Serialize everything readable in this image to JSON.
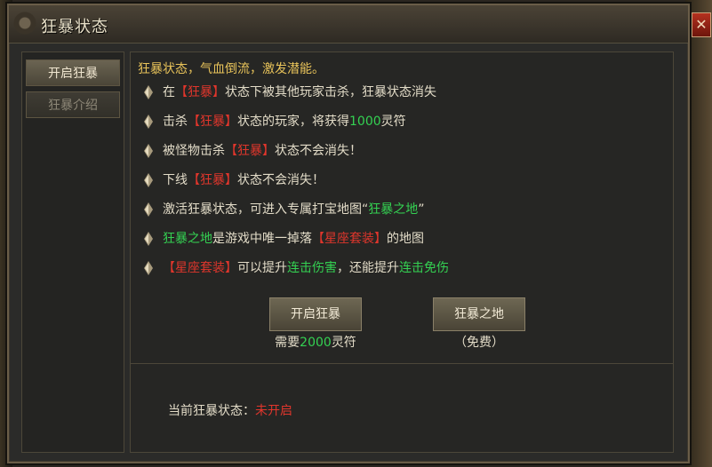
{
  "window": {
    "title": "狂暴状态",
    "close_label": "✕"
  },
  "sidebar": {
    "tabs": [
      {
        "label": "开启狂暴",
        "active": true
      },
      {
        "label": "狂暴介绍",
        "active": false
      }
    ]
  },
  "content": {
    "headline": "狂暴状态，气血倒流，激发潜能。",
    "rules": [
      {
        "parts": [
          {
            "t": "在",
            "c": "w"
          },
          {
            "t": "【狂暴】",
            "c": "r"
          },
          {
            "t": "状态下被其他玩家击杀，狂暴状态消失",
            "c": "w"
          }
        ]
      },
      {
        "parts": [
          {
            "t": "击杀",
            "c": "w"
          },
          {
            "t": "【狂暴】",
            "c": "r"
          },
          {
            "t": "状态的玩家，将获得",
            "c": "w"
          },
          {
            "t": "1000",
            "c": "g"
          },
          {
            "t": "灵符",
            "c": "w"
          }
        ]
      },
      {
        "parts": [
          {
            "t": "被怪物击杀",
            "c": "w"
          },
          {
            "t": "【狂暴】",
            "c": "r"
          },
          {
            "t": "状态不会消失！",
            "c": "w"
          }
        ]
      },
      {
        "parts": [
          {
            "t": "下线",
            "c": "w"
          },
          {
            "t": "【狂暴】",
            "c": "r"
          },
          {
            "t": "状态不会消失！",
            "c": "w"
          }
        ]
      },
      {
        "parts": [
          {
            "t": "激活狂暴状态，可进入专属打宝地图",
            "c": "w"
          },
          {
            "t": "“",
            "c": "w"
          },
          {
            "t": "狂暴之地",
            "c": "g"
          },
          {
            "t": "”",
            "c": "w"
          }
        ]
      },
      {
        "parts": [
          {
            "t": "狂暴之地",
            "c": "g"
          },
          {
            "t": "是游戏中唯一掉落",
            "c": "w"
          },
          {
            "t": "【星座套装】",
            "c": "r"
          },
          {
            "t": "的地图",
            "c": "w"
          }
        ]
      },
      {
        "parts": [
          {
            "t": "【星座套装】",
            "c": "r"
          },
          {
            "t": "可以提升",
            "c": "w"
          },
          {
            "t": "连击伤害",
            "c": "g"
          },
          {
            "t": "，还能提升",
            "c": "w"
          },
          {
            "t": "连击免伤",
            "c": "g"
          }
        ]
      }
    ],
    "buttons": {
      "activate": {
        "label": "开启狂暴",
        "note_prefix": "需要",
        "note_value": "2000",
        "note_suffix": "灵符"
      },
      "enter_map": {
        "label": "狂暴之地",
        "note": "（免费）"
      }
    }
  },
  "footer": {
    "status_label": "当前狂暴状态：",
    "status_value": "未开启"
  },
  "colors": {
    "white_text": "#e3dcc8",
    "red_text": "#e0362c",
    "green_text": "#34d152",
    "gold_text": "#e8c35a"
  },
  "icons": {
    "bullet": "diamond-bullet-icon",
    "close": "close-icon"
  }
}
